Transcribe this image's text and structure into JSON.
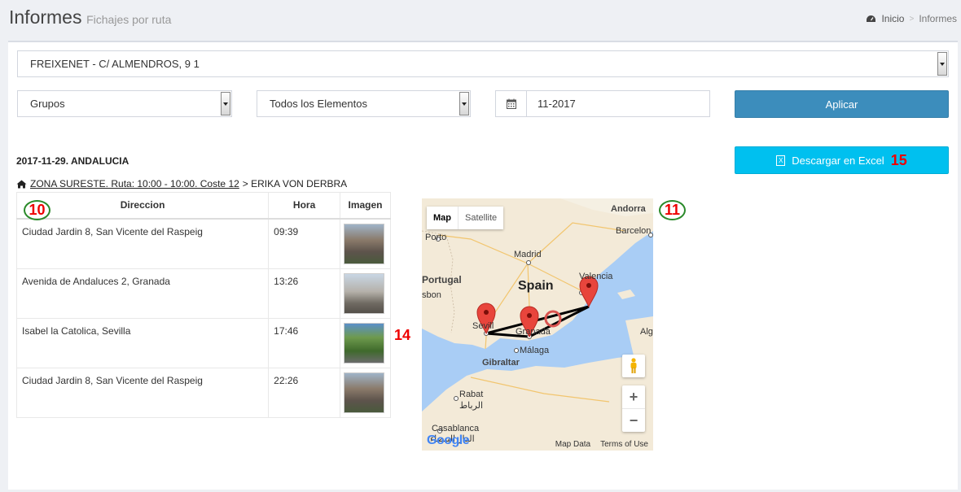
{
  "header": {
    "title": "Informes",
    "subtitle": "Fichajes por ruta"
  },
  "breadcrumb": {
    "home": "Inicio",
    "current": "Informes"
  },
  "filters": {
    "location": "FREIXENET - C/ ALMENDROS, 9 1",
    "groups": "Grupos",
    "elements": "Todos los Elementos",
    "date": "11-2017",
    "apply_label": "Aplicar"
  },
  "excel": {
    "label": "Descargar en Excel",
    "annotation": "15"
  },
  "report": {
    "day_title": "2017-11-29. ANDALUCIA",
    "route_link": "ZONA SURESTE. Ruta: 10:00 - 10:00. Coste 12",
    "route_suffix": "> ERIKA VON DERBRA"
  },
  "table": {
    "headers": {
      "direccion": "Direccion",
      "hora": "Hora",
      "imagen": "Imagen"
    },
    "rows": [
      {
        "direccion": "Ciudad Jardin 8, San Vicente del Raspeig",
        "hora": "09:39"
      },
      {
        "direccion": "Avenida de Andaluces 2, Granada",
        "hora": "13:26"
      },
      {
        "direccion": "Isabel la Catolica, Sevilla",
        "hora": "17:46"
      },
      {
        "direccion": "Ciudad Jardin 8, San Vicente del Raspeig",
        "hora": "22:26"
      }
    ]
  },
  "annotations": {
    "table": "10",
    "map": "11",
    "row": "14"
  },
  "map": {
    "type_map": "Map",
    "type_satellite": "Satellite",
    "labels": {
      "andorra": "Andorra",
      "porto": "Porto",
      "barcelona": "Barcelon",
      "madrid": "Madrid",
      "portugal": "Portugal",
      "spain": "Spain",
      "valencia": "Valencia",
      "lisbon": "sbon",
      "sevilla": "Sevill",
      "granada": "Granada",
      "malaga": "Málaga",
      "gibraltar": "Gibraltar",
      "alg": "Alg",
      "rabat": "Rabat",
      "rabat_ar": "الرباط",
      "casablanca": "Casablanca",
      "casablanca_ar": "الدار البيضاء"
    },
    "zoom_in": "+",
    "zoom_out": "−",
    "map_data": "Map Data",
    "terms": "Terms of Use",
    "logo": "Google"
  },
  "colors": {
    "primary": "#3c8dbc",
    "info": "#00c0ef",
    "marker": "#e8453c"
  }
}
